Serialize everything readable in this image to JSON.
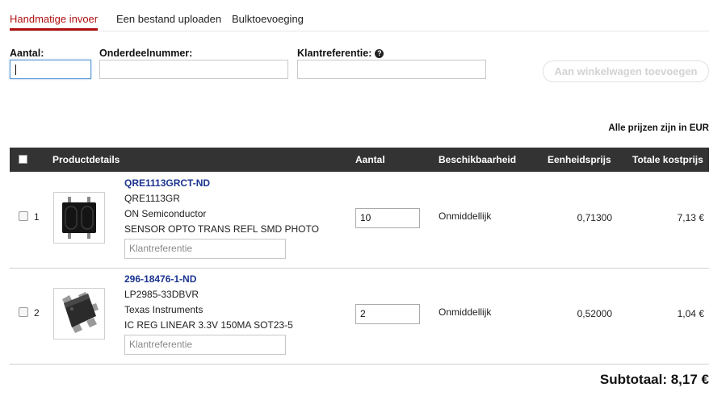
{
  "tabs": [
    {
      "label": "Handmatige invoer",
      "active": true
    },
    {
      "label": "Een bestand uploaden",
      "active": false
    },
    {
      "label": "Bulktoevoeging",
      "active": false
    }
  ],
  "form": {
    "quantity_label": "Aantal:",
    "quantity_value": "",
    "part_label": "Onderdeelnummer:",
    "part_value": "",
    "customer_ref_label": "Klantreferentie:",
    "customer_ref_value": "",
    "add_button": "Aan winkelwagen toevoegen"
  },
  "price_note": "Alle prijzen zijn in EUR",
  "table": {
    "headers": {
      "details": "Productdetails",
      "quantity": "Aantal",
      "availability": "Beschikbaarheid",
      "unit_price": "Eenheidsprijs",
      "total_price": "Totale kostprijs"
    },
    "rows": [
      {
        "index": "1",
        "part_number": "QRE1113GRCT-ND",
        "mfr_part": "QRE1113GR",
        "manufacturer": "ON Semiconductor",
        "description": "SENSOR OPTO TRANS REFL SMD PHOTO",
        "customer_ref_placeholder": "Klantreferentie",
        "quantity": "10",
        "availability": "Onmiddellijk",
        "unit_price": "0,71300",
        "total_price": "7,13 €",
        "image_icon": "smd-photo-sensor-image"
      },
      {
        "index": "2",
        "part_number": "296-18476-1-ND",
        "mfr_part": "LP2985-33DBVR",
        "manufacturer": "Texas Instruments",
        "description": "IC REG LINEAR 3.3V 150MA SOT23-5",
        "customer_ref_placeholder": "Klantreferentie",
        "quantity": "2",
        "availability": "Onmiddellijk",
        "unit_price": "0,52000",
        "total_price": "1,04 €",
        "image_icon": "sot23-chip-image"
      }
    ]
  },
  "subtotal": "Subtotaal: 8,17 €",
  "colors": {
    "accent": "#b01111",
    "header_bg": "#333333",
    "link": "#1a3390"
  }
}
